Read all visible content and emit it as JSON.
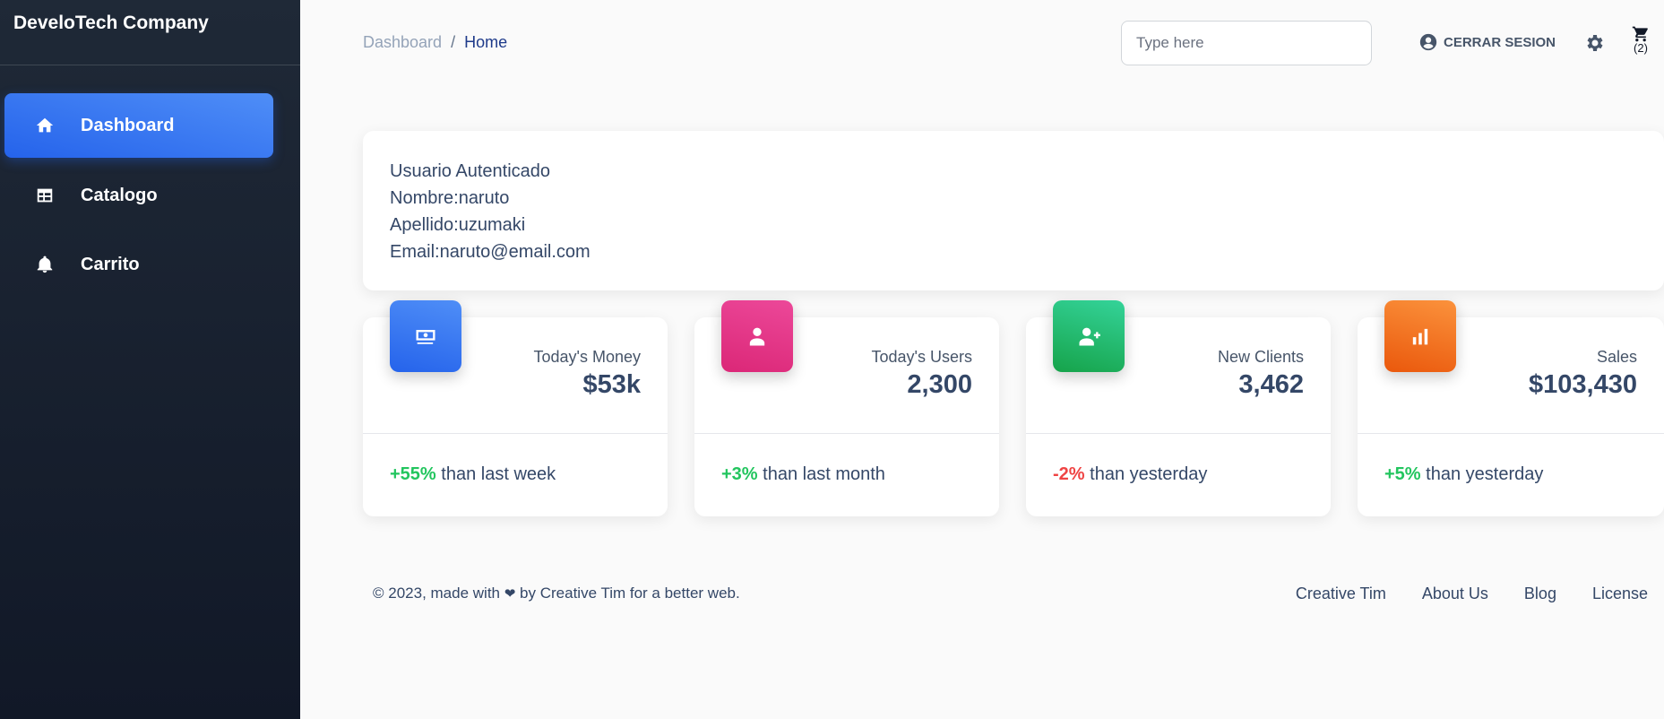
{
  "brand": "DeveloTech Company",
  "sidebar": {
    "items": [
      {
        "label": "Dashboard",
        "icon": "home-icon",
        "active": true
      },
      {
        "label": "Catalogo",
        "icon": "table-icon",
        "active": false
      },
      {
        "label": "Carrito",
        "icon": "bell-icon",
        "active": false
      }
    ]
  },
  "breadcrumb": {
    "parent": "Dashboard",
    "separator": "/",
    "current": "Home"
  },
  "search": {
    "placeholder": "Type here"
  },
  "header": {
    "logout_label": "CERRAR SESION",
    "cart_count": "(2)"
  },
  "user": {
    "title": "Usuario Autenticado",
    "name": "Nombre:naruto",
    "surname": "Apellido:uzumaki",
    "email": "Email:naruto@email.com"
  },
  "stats": [
    {
      "label": "Today's Money",
      "value": "$53k",
      "change": "+55%",
      "change_text": "than last week",
      "color": "#3b82f6"
    },
    {
      "label": "Today's Users",
      "value": "2,300",
      "change": "+3%",
      "change_text": "than last month",
      "color": "#ec4899"
    },
    {
      "label": "New Clients",
      "value": "3,462",
      "change": "-2%",
      "change_text": "than yesterday",
      "color": "#22c55e"
    },
    {
      "label": "Sales",
      "value": "$103,430",
      "change": "+5%",
      "change_text": "than yesterday",
      "color": "#f97316"
    }
  ],
  "footer": {
    "copyright": "© 2023, made with",
    "copyright_suffix": "by Creative Tim for a better web.",
    "links": [
      "Creative Tim",
      "About Us",
      "Blog",
      "License"
    ]
  }
}
